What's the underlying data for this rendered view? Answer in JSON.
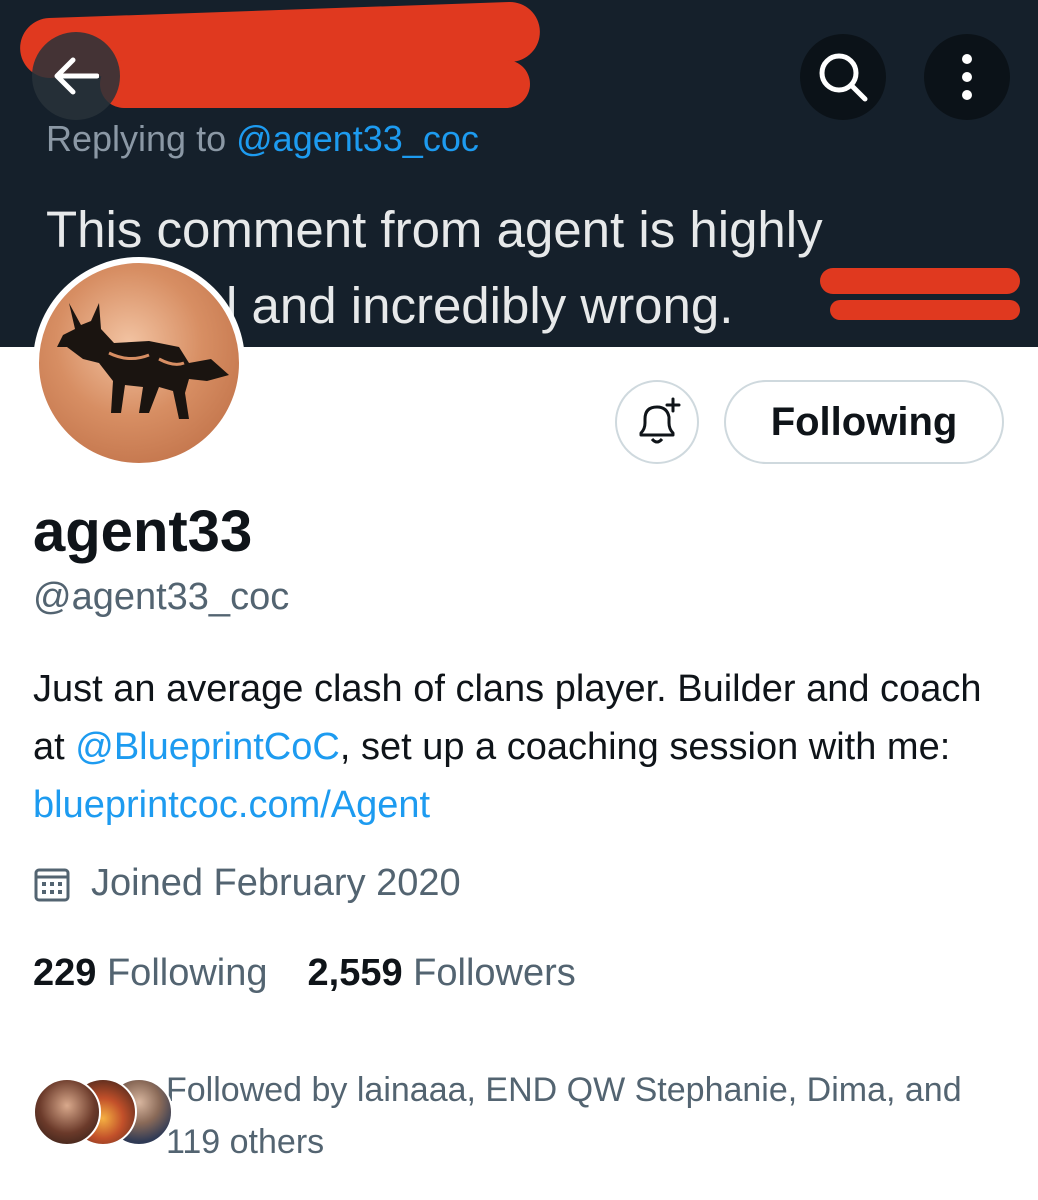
{
  "header": {
    "replying_prefix": "Replying to",
    "replying_handle": "@agent33_coc",
    "tweet_line1": "This comment from agent is highly",
    "tweet_line2": "l and incredibly wrong."
  },
  "actions": {
    "follow_button_label": "Following"
  },
  "profile": {
    "name": "agent33",
    "handle": "@agent33_coc",
    "bio": {
      "part1": "Just an average clash of clans player. Builder and coach at ",
      "mention": "@BlueprintCoC",
      "part2": ", set up a coaching session with me: ",
      "link": "blueprintcoc.com/Agent"
    },
    "joined": "Joined February 2020",
    "stats": {
      "following_count": "229",
      "following_label": "Following",
      "followers_count": "2,559",
      "followers_label": "Followers"
    },
    "followed_by": "Followed by lainaaa, END QW Stephanie, Dima, and 119 others"
  },
  "icons": {
    "back": "arrow-left-icon",
    "search": "search-icon",
    "more": "more-vertical-icon",
    "bell": "bell-plus-icon",
    "calendar": "calendar-icon"
  },
  "colors": {
    "banner_bg": "#15202b",
    "link": "#1d9bf0",
    "redaction": "#e0391f"
  }
}
